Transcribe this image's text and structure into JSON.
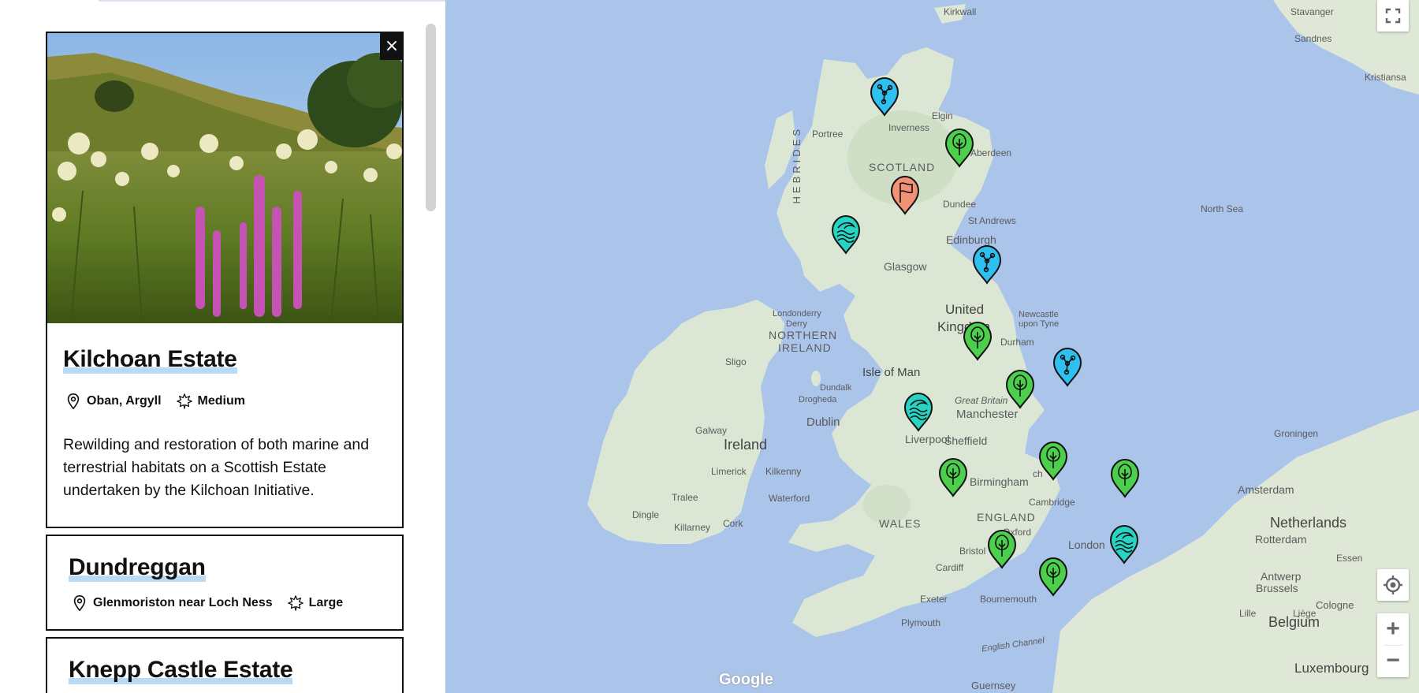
{
  "panel": {
    "cards": [
      {
        "title": "Kilchoan Estate",
        "location": "Oban, Argyll",
        "size": "Medium",
        "description": "Rewilding and restoration of both marine and terrestrial habitats on a Scottish Estate undertaken by the Kilchoan Initiative.",
        "close_icon": "×"
      },
      {
        "title": "Dundreggan",
        "location": "Glenmoriston near Loch Ness",
        "size": "Large"
      },
      {
        "title": "Knepp Castle Estate"
      }
    ]
  },
  "map": {
    "labels": {
      "kirkwall": "Kirkwall",
      "stavanger": "Stavanger",
      "sandnes": "Sandnes",
      "kristiansand": "Kristiansa",
      "portree": "Portree",
      "inverness": "Inverness",
      "elgin": "Elgin",
      "aberdeen": "Aberdeen",
      "scotland": "SCOTLAND",
      "hebrides": "HEBRIDES",
      "dundee": "Dundee",
      "st_andrews": "St Andrews",
      "edinburgh": "Edinburgh",
      "glasgow": "Glasgow",
      "north_sea": "North Sea",
      "united_kingdom_1": "United",
      "united_kingdom_2": "Kingdom",
      "londonderry": "Londonderry",
      "derry": "Derry",
      "northern_ireland_1": "NORTHERN",
      "northern_ireland_2": "IRELAND",
      "newcastle": "Newcastle",
      "upon_tyne": "upon Tyne",
      "durham": "Durham",
      "sligo": "Sligo",
      "isle_of_man": "Isle of Man",
      "dundalk": "Dundalk",
      "drogheda": "Drogheda",
      "great_britain": "Great Britain",
      "dublin": "Dublin",
      "manchester": "Manchester",
      "galway": "Galway",
      "ireland": "Ireland",
      "liverpool": "Liverpool",
      "sheffield": "Sheffield",
      "limerick": "Limerick",
      "kilkenny": "Kilkenny",
      "birmingham": "Birmingham",
      "norwich_fragment": "ch",
      "groningen": "Groningen",
      "tralee": "Tralee",
      "waterford": "Waterford",
      "cambridge": "Cambridge",
      "amsterdam": "Amsterdam",
      "dingle": "Dingle",
      "killarney": "Killarney",
      "cork": "Cork",
      "wales": "WALES",
      "england": "ENGLAND",
      "oxford": "Oxford",
      "netherlands": "Netherlands",
      "rotterdam": "Rotterdam",
      "bristol": "Bristol",
      "london": "London",
      "essen": "Essen",
      "cardiff": "Cardiff",
      "antwerp": "Antwerp",
      "brussels": "Brussels",
      "exeter": "Exeter",
      "bournemouth": "Bournemouth",
      "cologne": "Cologne",
      "lille": "Lille",
      "liege": "Liège",
      "belgium": "Belgium",
      "plymouth": "Plymouth",
      "english_channel": "English Channel",
      "luxembourg": "Luxembourg",
      "guernsey": "Guernsey",
      "google": "Google"
    },
    "controls": {
      "fullscreen_icon": "fullscreen-icon",
      "zoom_in": "+",
      "zoom_out": "−"
    },
    "marker_colors": {
      "tree": "#4ccf4c",
      "network": "#2fc0f2",
      "marine": "#27d3c3",
      "flag": "#f39176"
    },
    "markers": [
      {
        "type": "network"
      },
      {
        "type": "tree"
      },
      {
        "type": "flag"
      },
      {
        "type": "marine"
      },
      {
        "type": "network"
      },
      {
        "type": "tree"
      },
      {
        "type": "network"
      },
      {
        "type": "tree"
      },
      {
        "type": "marine"
      },
      {
        "type": "tree"
      },
      {
        "type": "tree"
      },
      {
        "type": "tree"
      },
      {
        "type": "tree"
      },
      {
        "type": "marine"
      },
      {
        "type": "tree"
      }
    ]
  }
}
